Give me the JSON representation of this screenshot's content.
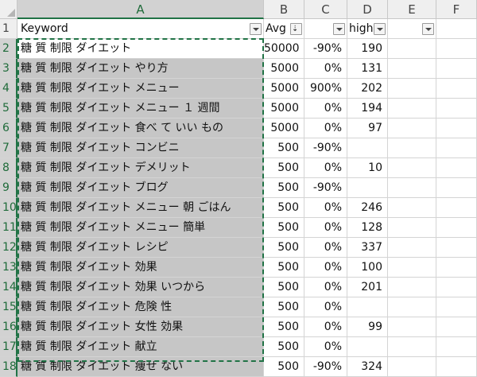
{
  "columns": [
    {
      "id": "A",
      "label": "A",
      "selected": true
    },
    {
      "id": "B",
      "label": "B",
      "selected": false
    },
    {
      "id": "C",
      "label": "C",
      "selected": false
    },
    {
      "id": "D",
      "label": "D",
      "selected": false
    },
    {
      "id": "E",
      "label": "E",
      "selected": false
    },
    {
      "id": "F",
      "label": "F",
      "selected": false
    }
  ],
  "header_row": {
    "row_number": "1",
    "cells": [
      "Keyword",
      "Avg",
      "",
      "high",
      "",
      ""
    ]
  },
  "rows": [
    {
      "n": "2",
      "keyword": "糖 質 制限 ダイエット",
      "avg": "50000",
      "c": "-90%",
      "d": "190"
    },
    {
      "n": "3",
      "keyword": "糖 質 制限 ダイエット やり方",
      "avg": "5000",
      "c": "0%",
      "d": "131"
    },
    {
      "n": "4",
      "keyword": "糖 質 制限 ダイエット メニュー",
      "avg": "5000",
      "c": "900%",
      "d": "202"
    },
    {
      "n": "5",
      "keyword": "糖 質 制限 ダイエット メニュー １ 週間",
      "avg": "5000",
      "c": "0%",
      "d": "194"
    },
    {
      "n": "6",
      "keyword": "糖 質 制限 ダイエット 食べ て いい もの",
      "avg": "5000",
      "c": "0%",
      "d": "97"
    },
    {
      "n": "7",
      "keyword": "糖 質 制限 ダイエット コンビニ",
      "avg": "500",
      "c": "-90%",
      "d": ""
    },
    {
      "n": "8",
      "keyword": "糖 質 制限 ダイエット デメリット",
      "avg": "500",
      "c": "0%",
      "d": "10"
    },
    {
      "n": "9",
      "keyword": "糖 質 制限 ダイエット ブログ",
      "avg": "500",
      "c": "-90%",
      "d": ""
    },
    {
      "n": "10",
      "keyword": "糖 質 制限 ダイエット メニュー 朝 ごはん",
      "avg": "500",
      "c": "0%",
      "d": "246"
    },
    {
      "n": "11",
      "keyword": "糖 質 制限 ダイエット メニュー 簡単",
      "avg": "500",
      "c": "0%",
      "d": "128"
    },
    {
      "n": "12",
      "keyword": "糖 質 制限 ダイエット レシピ",
      "avg": "500",
      "c": "0%",
      "d": "337"
    },
    {
      "n": "13",
      "keyword": "糖 質 制限 ダイエット 効果",
      "avg": "500",
      "c": "0%",
      "d": "100"
    },
    {
      "n": "14",
      "keyword": "糖 質 制限 ダイエット 効果 いつから",
      "avg": "500",
      "c": "0%",
      "d": "201"
    },
    {
      "n": "15",
      "keyword": "糖 質 制限 ダイエット 危険 性",
      "avg": "500",
      "c": "0%",
      "d": ""
    },
    {
      "n": "16",
      "keyword": "糖 質 制限 ダイエット 女性 効果",
      "avg": "500",
      "c": "0%",
      "d": "99"
    },
    {
      "n": "17",
      "keyword": "糖 質 制限 ダイエット 献立",
      "avg": "500",
      "c": "0%",
      "d": ""
    },
    {
      "n": "18",
      "keyword": "糖 質 制限 ダイエット 痩せ ない",
      "avg": "500",
      "c": "-90%",
      "d": "324"
    }
  ],
  "colors": {
    "selection_green": "#217346",
    "selected_fill": "#c6c6c6",
    "header_bg": "#efefef"
  },
  "icons": {
    "filter": "filter-dropdown-icon",
    "sort": "sort-descending-filter-icon"
  }
}
